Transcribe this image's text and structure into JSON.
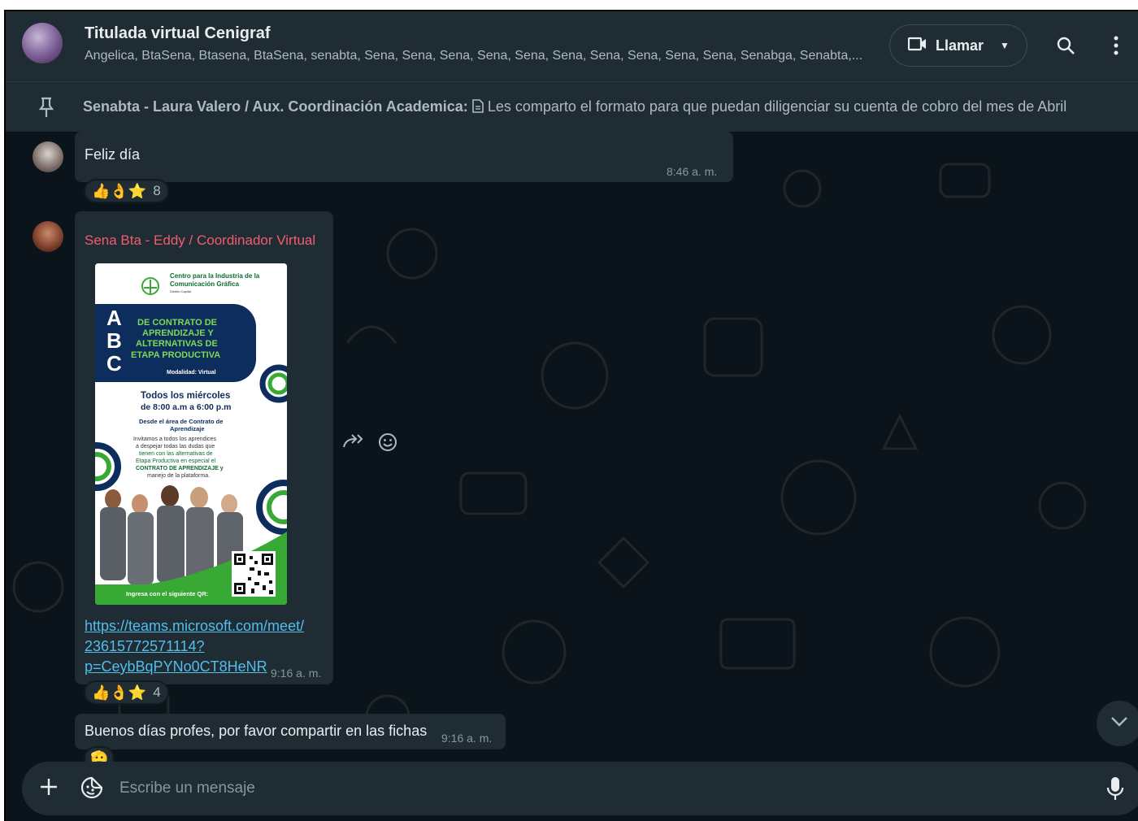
{
  "header": {
    "title": "Titulada virtual Cenigraf",
    "members": "Angelica, BtaSena, Btasena, BtaSena,   senabta, Sena, Sena, Sena, Sena, Sena, Sena, Sena, Sena, Sena, Sena, Senabga, Senabta,...",
    "call_label": "Llamar"
  },
  "pinned": {
    "author": "Senabta - Laura Valero / Aux. Coordinación Academica:",
    "text": "Les comparto el formato para que puedan diligenciar su cuenta de cobro del mes de Abril"
  },
  "messages": [
    {
      "text": "Feliz día",
      "time": "8:46 a. m.",
      "reactions": "👍👌⭐",
      "reaction_count": "8"
    },
    {
      "sender": "Sena Bta - Eddy / Coordinador Virtual",
      "poster": {
        "org_line1": "Centro para la Industria de la",
        "org_line2": "Comunicación Gráfica",
        "org_line3": "Distrito Capital",
        "abc_a": "A",
        "abc_b": "B",
        "abc_c": "C",
        "headline1": "DE CONTRATO DE",
        "headline2": "APRENDIZAJE Y",
        "headline3": "ALTERNATIVAS DE",
        "headline4": "ETAPA PRODUCTIVA",
        "modalidad": "Modalidad: Virtual",
        "schedule1": "Todos los miércoles",
        "schedule2": "de 8:00 a.m a 6:00 p.m",
        "area1": "Desde el área de Contrato de",
        "area2": "Aprendizaje",
        "body1": "Invitamos a todos los aprendices",
        "body2": "a despejar todas las dudas que",
        "body3": "tienen con las alternativas de",
        "body4": "Etapa Productiva en especial el",
        "body5": "CONTRATO DE APRENDIZAJE y",
        "body6": "manejo de la plataforma.",
        "qr_label": "Ingresa con el siguiente QR:"
      },
      "link": "https://teams.microsoft.com/meet/23615772571114?p=CeybBqPYNo0CT8HeNR",
      "link_line1": "https://teams.microsoft.com/meet/",
      "link_line2": "23615772571114?",
      "link_line3": "p=CeybBqPYNo0CT8HeNR",
      "time": "9:16 a. m.",
      "reactions": "👍👌⭐",
      "reaction_count": "4"
    },
    {
      "text": "Buenos días profes, por favor compartir en las fichas",
      "time": "9:16 a. m.",
      "reactions": "🫡"
    }
  ],
  "composer": {
    "placeholder": "Escribe un mensaje"
  },
  "colors": {
    "background": "#0b141a",
    "panel": "#202c33",
    "sender": "#f15c6d",
    "link": "#53bdeb",
    "poster_navy": "#0d2d5c",
    "poster_green": "#39a935"
  },
  "icons": [
    "video-icon",
    "caret-down-icon",
    "search-icon",
    "menu-icon",
    "pin-icon",
    "document-icon",
    "forward-icon",
    "emoji-icon",
    "chevron-down-icon",
    "plus-icon",
    "sticker-icon",
    "mic-icon"
  ]
}
